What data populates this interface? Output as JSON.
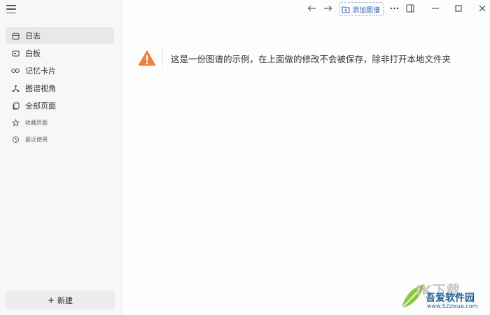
{
  "sidebar": {
    "nav_items": [
      {
        "label": "日志",
        "icon": "calendar-icon",
        "active": true
      },
      {
        "label": "白板",
        "icon": "whiteboard-icon"
      },
      {
        "label": "记忆卡片",
        "icon": "infinity-icon"
      },
      {
        "label": "图谱视角",
        "icon": "graph-icon"
      },
      {
        "label": "全部页面",
        "icon": "pages-icon"
      },
      {
        "label": "收藏页面",
        "icon": "star-icon"
      },
      {
        "label": "最近使用",
        "icon": "history-icon"
      }
    ],
    "new_label": "新建",
    "new_plus": "+"
  },
  "topbar": {
    "add_graph_label": "添加图谱"
  },
  "notice": {
    "message": "这是一份图谱的示例，在上面做的修改不会被保存，除非打开本地文件夹"
  },
  "watermark": {
    "line1": "IK下载",
    "line2": "吾爱软件园",
    "line3": "www.52zixue.com"
  },
  "colors": {
    "accent": "#2d5fae",
    "warning": "#f07f3c",
    "sidebar_bg": "#f7f7f7"
  }
}
